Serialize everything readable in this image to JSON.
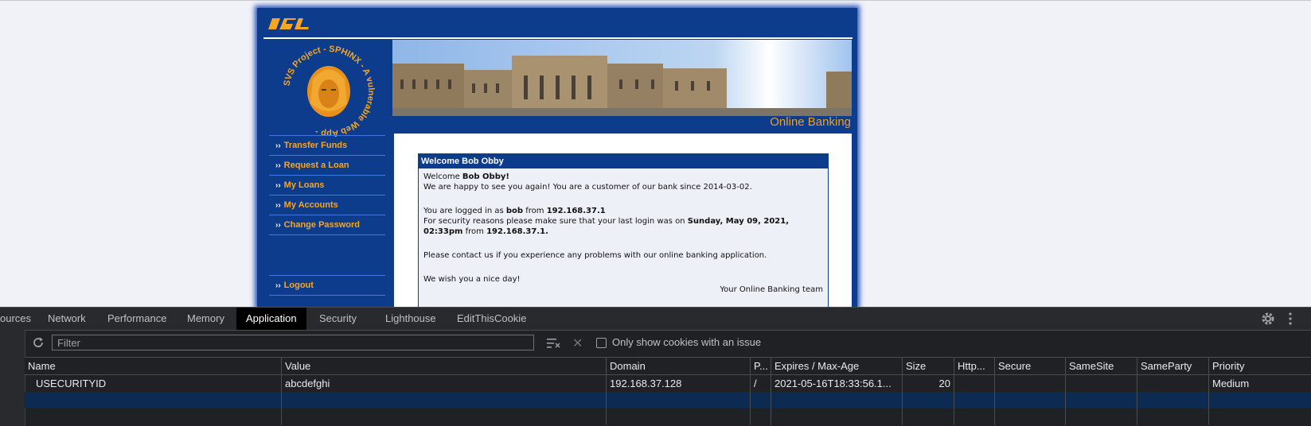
{
  "site": {
    "logo_text": "ISL",
    "emblem_text": "SVS Project - SPHINX - A vulnerable Web App -",
    "banner_subtitle": "Online Banking",
    "nav": [
      {
        "label": "Transfer Funds"
      },
      {
        "label": "Request a Loan"
      },
      {
        "label": "My Loans"
      },
      {
        "label": "My Accounts"
      },
      {
        "label": "Change Password"
      }
    ],
    "logout_label": "Logout",
    "welcome": {
      "title": "Welcome Bob Obby",
      "greeting_prefix": "Welcome ",
      "greeting_name": "Bob Obby!",
      "line1": "We are happy to see you again! You are a customer of our bank since 2014-03-02.",
      "login_prefix": "You are logged in as ",
      "login_user": "bob",
      "login_mid": " from ",
      "login_ip": "192.168.37.1",
      "security_prefix": "For security reasons please make sure that your last login was on ",
      "security_date": "Sunday, May 09, 2021, 02:33pm",
      "security_mid": " from ",
      "security_ip": "192.168.37.1.",
      "contact": "Please contact us if you experience any problems with our online banking application.",
      "wish": "We wish you a nice day!",
      "signature": "Your Online Banking team"
    }
  },
  "devtools": {
    "tabs": [
      {
        "label": "ources"
      },
      {
        "label": "Network"
      },
      {
        "label": "Performance"
      },
      {
        "label": "Memory"
      },
      {
        "label": "Application"
      },
      {
        "label": "Security"
      },
      {
        "label": "Lighthouse"
      },
      {
        "label": "EditThisCookie"
      }
    ],
    "active_tab": "Application",
    "filter_placeholder": "Filter",
    "only_issues_label": "Only show cookies with an issue",
    "columns": [
      "Name",
      "Value",
      "Domain",
      "P...",
      "Expires / Max-Age",
      "Size",
      "Http...",
      "Secure",
      "SameSite",
      "SameParty",
      "Priority"
    ],
    "rows": [
      {
        "name": "USECURITYID",
        "value": "abcdefghi",
        "domain": "192.168.37.128",
        "path": "/",
        "expires": "2021-05-16T18:33:56.1...",
        "size": "20",
        "httponly": "",
        "secure": "",
        "samesite": "",
        "sameparty": "",
        "priority": "Medium"
      }
    ]
  }
}
